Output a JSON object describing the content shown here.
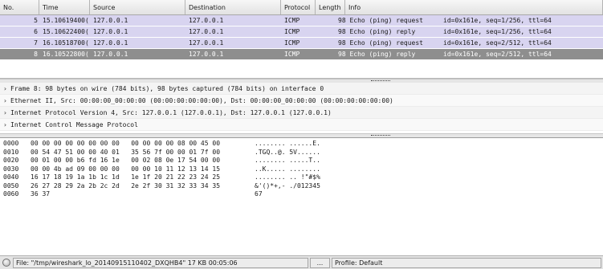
{
  "packet_list": {
    "columns": [
      "No.",
      "Time",
      "Source",
      "Destination",
      "Protocol",
      "Length",
      "Info"
    ],
    "rows": [
      {
        "no": "5",
        "time": "15.10619400(",
        "src": "127.0.0.1",
        "dst": "127.0.0.1",
        "proto": "ICMP",
        "len": "",
        "info_a": "98 Echo (ping) request",
        "info_b": "id=0x161e, seq=1/256, ttl=64",
        "selected": false
      },
      {
        "no": "6",
        "time": "15.10622400(",
        "src": "127.0.0.1",
        "dst": "127.0.0.1",
        "proto": "ICMP",
        "len": "",
        "info_a": "98 Echo (ping) reply",
        "info_b": "id=0x161e, seq=1/256, ttl=64",
        "selected": false
      },
      {
        "no": "7",
        "time": "16.10518700(",
        "src": "127.0.0.1",
        "dst": "127.0.0.1",
        "proto": "ICMP",
        "len": "",
        "info_a": "98 Echo (ping) request",
        "info_b": "id=0x161e, seq=2/512, ttl=64",
        "selected": false
      },
      {
        "no": "8",
        "time": "16.10522800(",
        "src": "127.0.0.1",
        "dst": "127.0.0.1",
        "proto": "ICMP",
        "len": "",
        "info_a": "98 Echo (ping) reply",
        "info_b": "id=0x161e, seq=2/512, ttl=64",
        "selected": true
      }
    ]
  },
  "details": {
    "rows": [
      "Frame 8: 98 bytes on wire (784 bits), 98 bytes captured (784 bits) on interface 0",
      "Ethernet II, Src: 00:00:00_00:00:00 (00:00:00:00:00:00), Dst: 00:00:00_00:00:00 (00:00:00:00:00:00)",
      "Internet Protocol Version 4, Src: 127.0.0.1 (127.0.0.1), Dst: 127.0.0.1 (127.0.0.1)",
      "Internet Control Message Protocol"
    ]
  },
  "bytes": {
    "rows": [
      {
        "offset": "0000",
        "hex": "00 00 00 00 00 00 00 00   00 00 00 00 08 00 45 00",
        "ascii": "........ ......E."
      },
      {
        "offset": "0010",
        "hex": "00 54 47 51 00 00 40 01   35 56 7f 00 00 01 7f 00",
        "ascii": ".TGQ..@. 5V......"
      },
      {
        "offset": "0020",
        "hex": "00 01 00 00 b6 fd 16 1e   00 02 08 0e 17 54 00 00",
        "ascii": "........ .....T.."
      },
      {
        "offset": "0030",
        "hex": "00 00 4b ad 09 00 00 00   00 00 10 11 12 13 14 15",
        "ascii": "..K..... ........"
      },
      {
        "offset": "0040",
        "hex": "16 17 18 19 1a 1b 1c 1d   1e 1f 20 21 22 23 24 25",
        "ascii": "........ .. !\"#$%"
      },
      {
        "offset": "0050",
        "hex": "26 27 28 29 2a 2b 2c 2d   2e 2f 30 31 32 33 34 35",
        "ascii": "&'()*+,- ./012345"
      },
      {
        "offset": "0060",
        "hex": "36 37",
        "ascii": "67"
      }
    ]
  },
  "statusbar": {
    "file": "File: \"/tmp/wireshark_lo_20140915110402_DXQHB4\" 17 KB 00:05:06",
    "middle": "...",
    "profile": "Profile: Default"
  },
  "colors": {
    "row_bg": "#d8d4f0",
    "selected_bg": "#8e8e8e"
  }
}
